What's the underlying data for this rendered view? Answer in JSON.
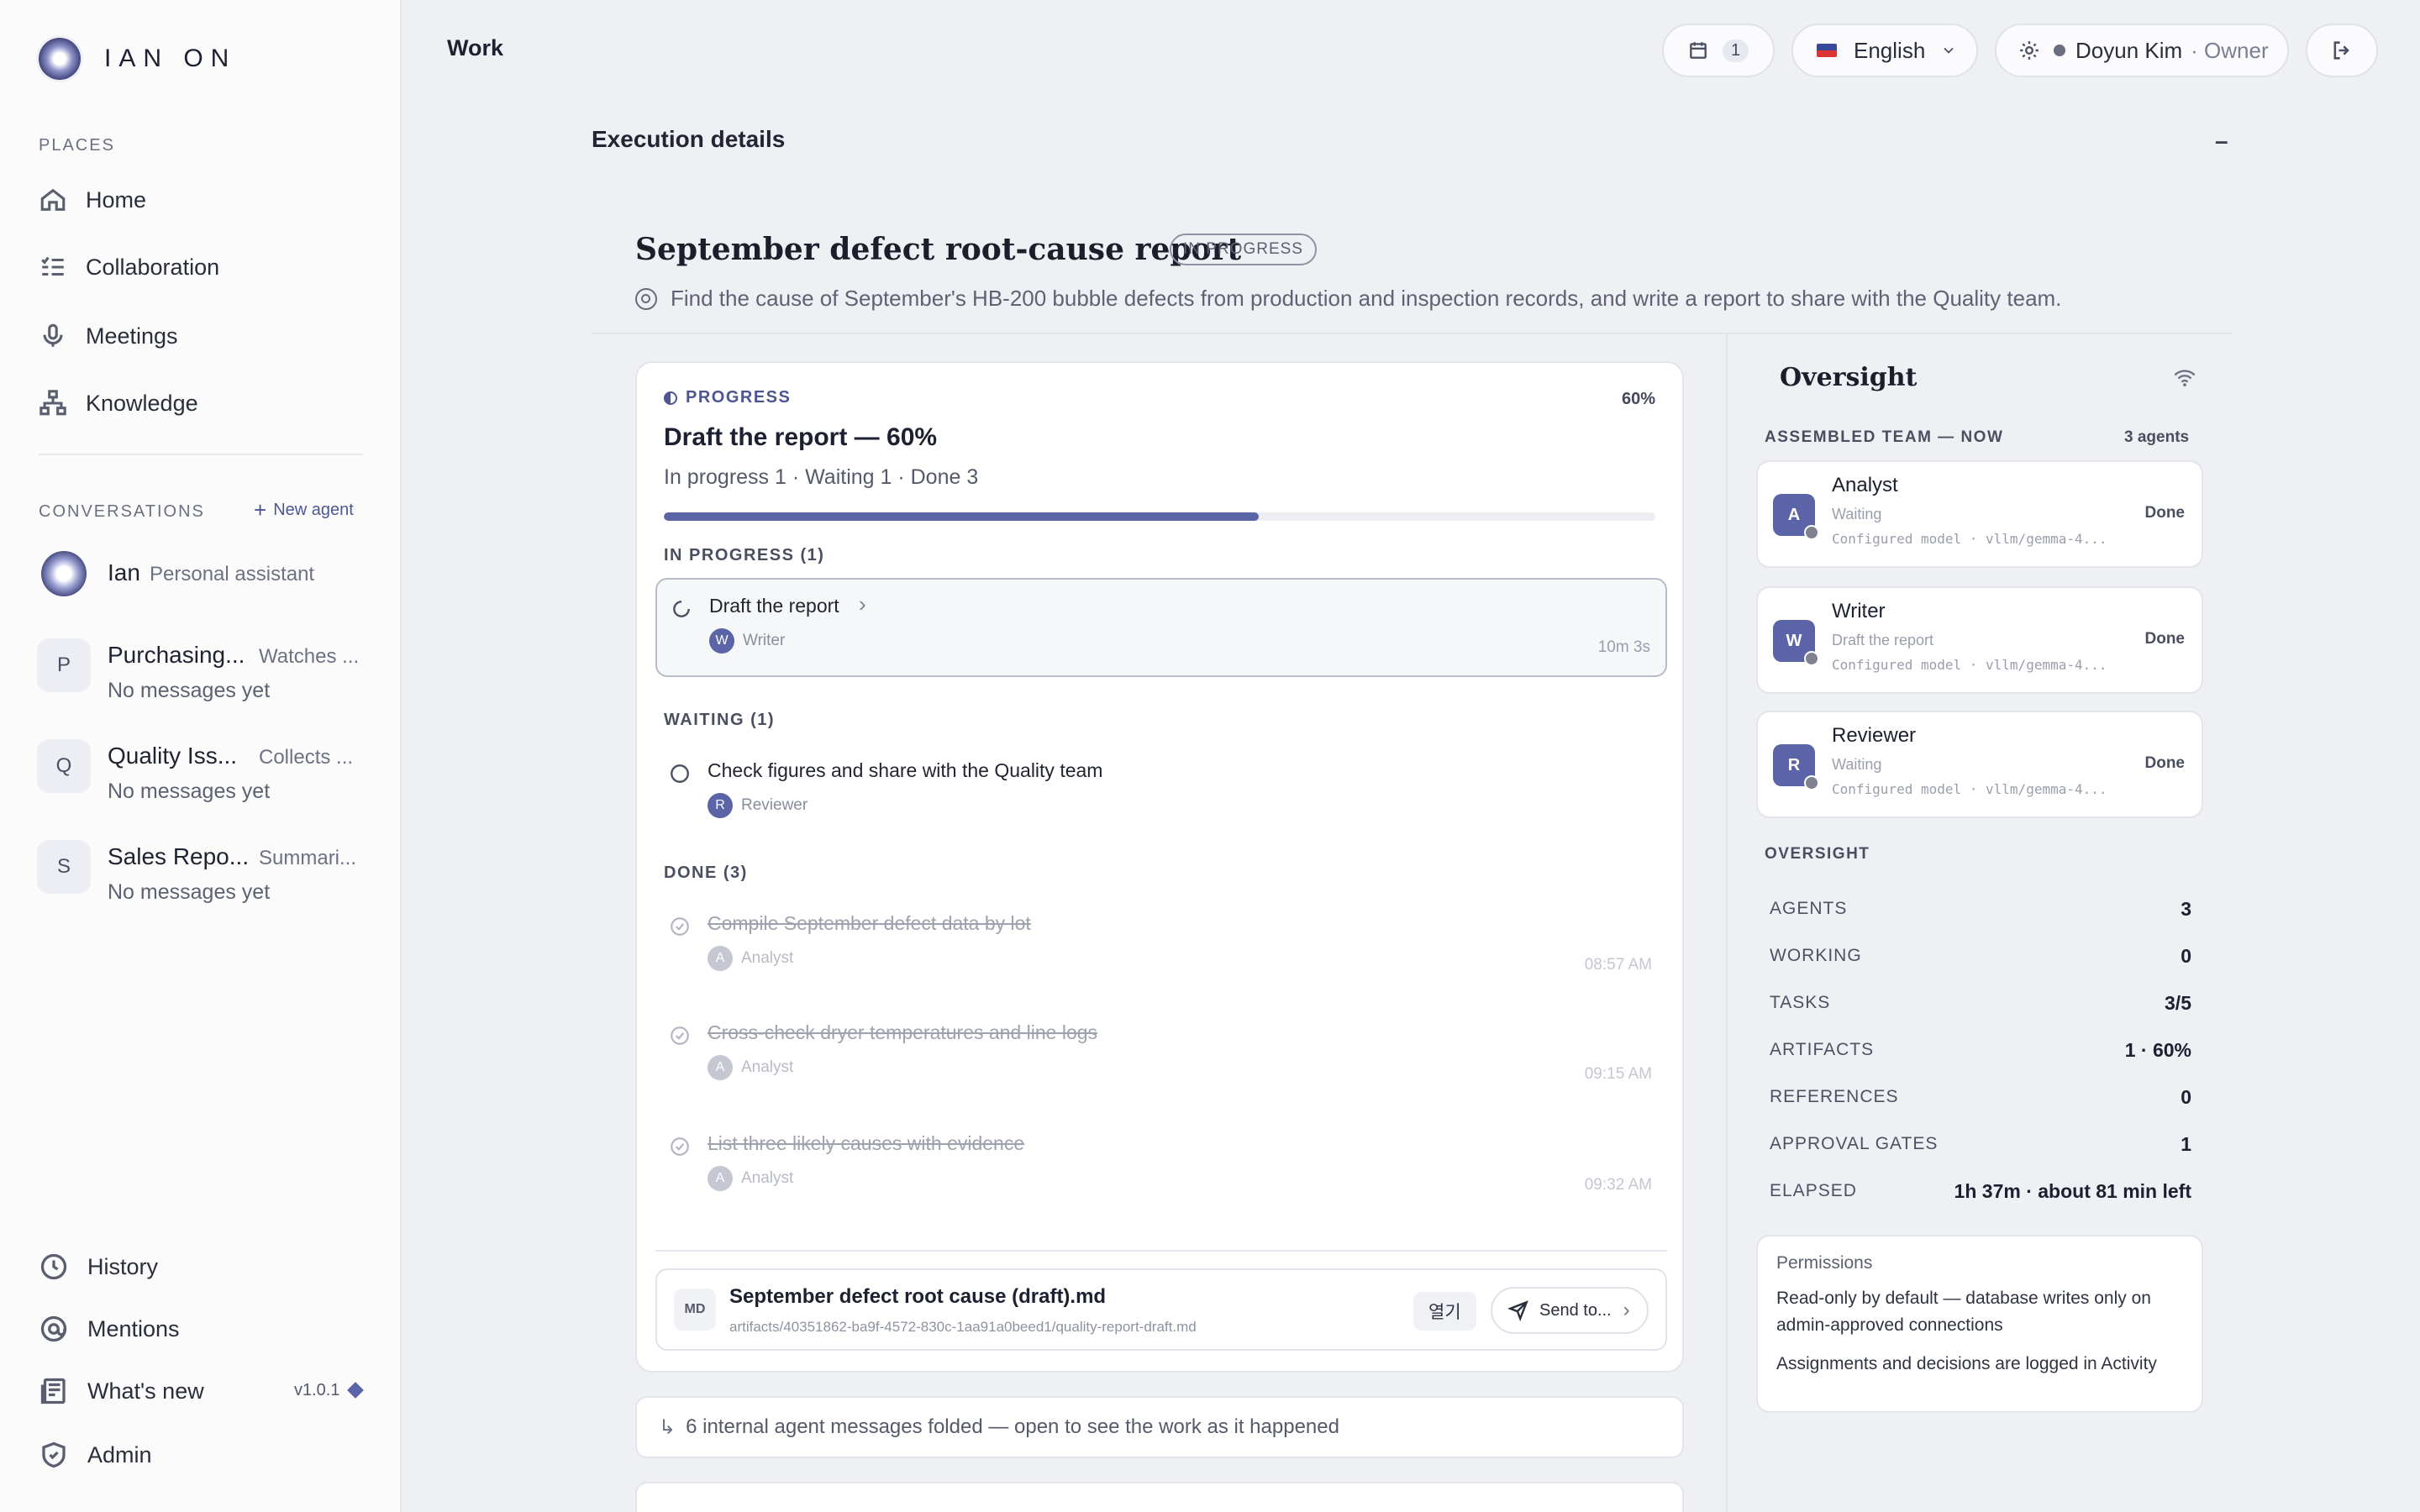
{
  "brand": {
    "name": "IAN ON"
  },
  "sidebar": {
    "places_label": "PLACES",
    "places": [
      {
        "label": "Home",
        "icon": "home-icon"
      },
      {
        "label": "Collaboration",
        "icon": "checklist-icon"
      },
      {
        "label": "Meetings",
        "icon": "microphone-icon"
      },
      {
        "label": "Knowledge",
        "icon": "hierarchy-icon"
      }
    ],
    "conversations_label": "CONVERSATIONS",
    "new_agent_label": "New agent",
    "conversations": [
      {
        "initial": "",
        "name": "Ian",
        "desc": "Personal assistant",
        "sub": ""
      },
      {
        "initial": "P",
        "name": "Purchasing...",
        "desc": "Watches ...",
        "sub": "No messages yet"
      },
      {
        "initial": "Q",
        "name": "Quality Iss...",
        "desc": "Collects ...",
        "sub": "No messages yet"
      },
      {
        "initial": "S",
        "name": "Sales Repo...",
        "desc": "Summari...",
        "sub": "No messages yet"
      }
    ],
    "bottom": [
      {
        "label": "History",
        "icon": "clock-icon"
      },
      {
        "label": "Mentions",
        "icon": "at-icon"
      },
      {
        "label": "What's new",
        "icon": "news-icon"
      },
      {
        "label": "Admin",
        "icon": "shield-icon"
      }
    ],
    "version": "v1.0.1"
  },
  "topbar": {
    "title": "Work",
    "calendar_count": "1",
    "language": "English",
    "user_name": "Doyun Kim",
    "user_role": "· Owner"
  },
  "main": {
    "section_title": "Execution details",
    "collapse_label": "–",
    "doc_title": "September defect root-cause report",
    "status": "IN PROGRESS",
    "goal": "Find the cause of September's HB-200 bubble defects from production and inspection records, and write a report to share with the Quality team."
  },
  "progress": {
    "label": "PROGRESS",
    "percent_label": "60%",
    "fraction": 0.6,
    "title": "Draft the report — 60%",
    "counts": "In progress 1 · Waiting 1 · Done 3",
    "in_progress_label": "IN PROGRESS (1)",
    "waiting_label": "WAITING (1)",
    "done_label": "DONE (3)",
    "in_progress": [
      {
        "title": "Draft the report",
        "agent_initial": "W",
        "agent": "Writer",
        "time": "10m 3s"
      }
    ],
    "waiting": [
      {
        "title": "Check figures and share with the Quality team",
        "agent_initial": "R",
        "agent": "Reviewer",
        "time": ""
      }
    ],
    "done": [
      {
        "title": "Compile September defect data by lot",
        "agent_initial": "A",
        "agent": "Analyst",
        "time": "08:57 AM"
      },
      {
        "title": "Cross-check dryer temperatures and line logs",
        "agent_initial": "A",
        "agent": "Analyst",
        "time": "09:15 AM"
      },
      {
        "title": "List three likely causes with evidence",
        "agent_initial": "A",
        "agent": "Analyst",
        "time": "09:32 AM"
      }
    ]
  },
  "artifact": {
    "type": "MD",
    "name": "September defect root cause (draft).md",
    "path": "artifacts/40351862-ba9f-4572-830c-1aa91a0beed1/quality-report-draft.md",
    "open_label": "열기",
    "send_label": "Send to..."
  },
  "folded": {
    "text": "6 internal agent messages folded — open to see the work as it happened"
  },
  "oversight": {
    "title": "Oversight",
    "team_label": "ASSEMBLED TEAM — NOW",
    "agent_count": "3 agents",
    "agents": [
      {
        "initial": "A",
        "name": "Analyst",
        "status": "Waiting",
        "model": "Configured model · vllm/gemma-4...",
        "state": "Done"
      },
      {
        "initial": "W",
        "name": "Writer",
        "status": "Draft the report",
        "model": "Configured model · vllm/gemma-4...",
        "state": "Done"
      },
      {
        "initial": "R",
        "name": "Reviewer",
        "status": "Waiting",
        "model": "Configured model · vllm/gemma-4...",
        "state": "Done"
      }
    ],
    "stats_label": "OVERSIGHT",
    "stats": [
      {
        "key": "AGENTS",
        "value": "3"
      },
      {
        "key": "WORKING",
        "value": "0"
      },
      {
        "key": "TASKS",
        "value": "3/5"
      },
      {
        "key": "ARTIFACTS",
        "value": "1 · 60%"
      },
      {
        "key": "REFERENCES",
        "value": "0"
      },
      {
        "key": "APPROVAL GATES",
        "value": "1"
      },
      {
        "key": "ELAPSED",
        "value": "1h 37m · about 81 min left"
      }
    ],
    "permissions": {
      "title": "Permissions",
      "line1": "Read-only by default — database writes only on admin-approved connections",
      "line2": "Assignments and decisions are logged in Activity"
    }
  },
  "colors": {
    "accent": "#5a64a6",
    "background": "#eef0f4"
  }
}
